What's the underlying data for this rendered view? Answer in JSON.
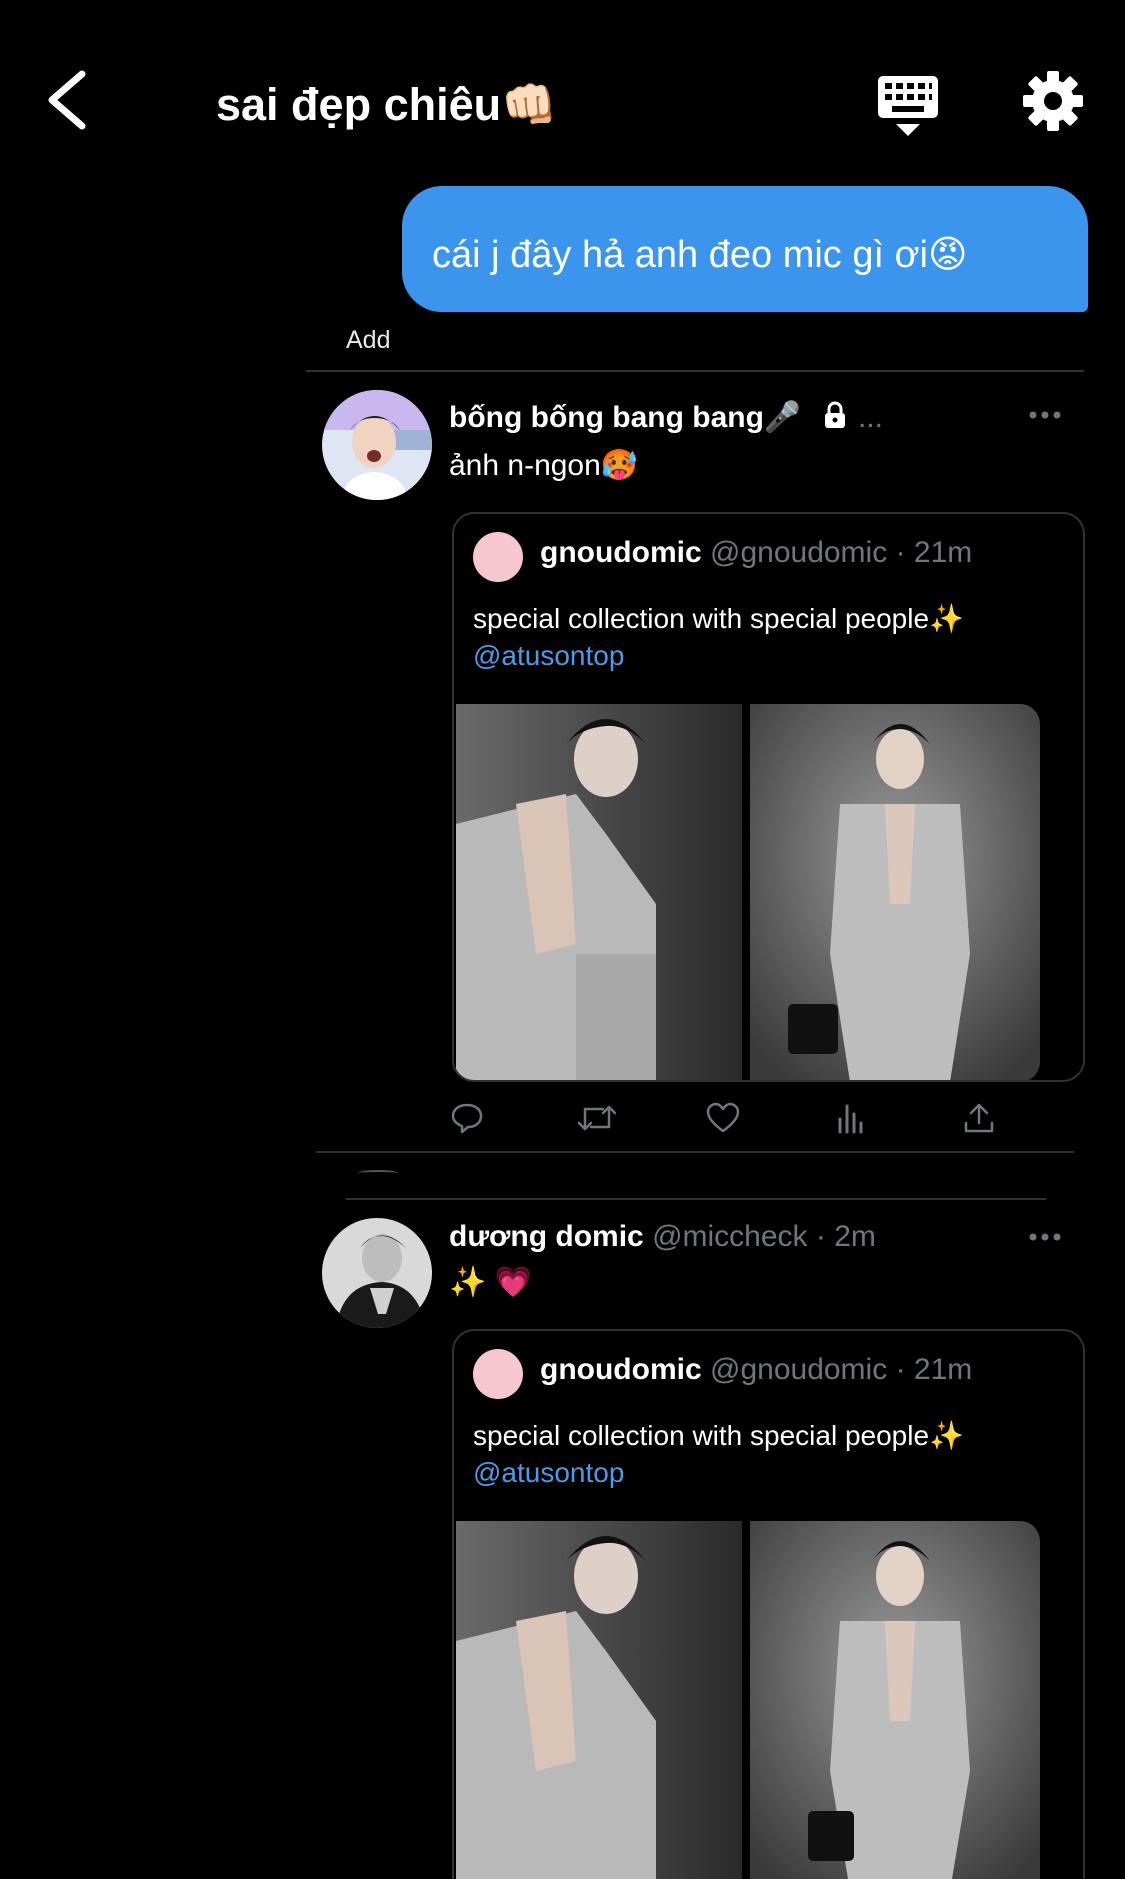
{
  "header": {
    "title": "sai đẹp chiêu👊🏻",
    "back_icon": "chevron-left-icon",
    "keyboard_icon": "keyboard-icon",
    "settings_icon": "gear-icon"
  },
  "outgoing_message": {
    "text": "cái j đây hả anh đeo mic gì ơi😡",
    "color": "#3b95ec"
  },
  "add_label": "Add",
  "tweets": [
    {
      "author_name": "bống bống bang bang🎤",
      "lock_icon": "lock-icon",
      "ellipsis": "...",
      "text": "ảnh n-ngon🥵",
      "quoted": {
        "name": "gnoudomic",
        "handle": "@gnoudomic",
        "time": "· 21m",
        "text": "special collection with special people✨",
        "mention": "@atusontop"
      }
    },
    {
      "author_name": "dương domic",
      "handle": "@miccheck",
      "time": "· 2m",
      "text": "✨ 💗",
      "quoted": {
        "name": "gnoudomic",
        "handle": "@gnoudomic",
        "time": "· 21m",
        "text": "special collection with special people✨",
        "mention": "@atusontop"
      }
    }
  ],
  "action_icons": [
    "reply-icon",
    "retweet-icon",
    "like-icon",
    "views-icon",
    "share-icon"
  ]
}
